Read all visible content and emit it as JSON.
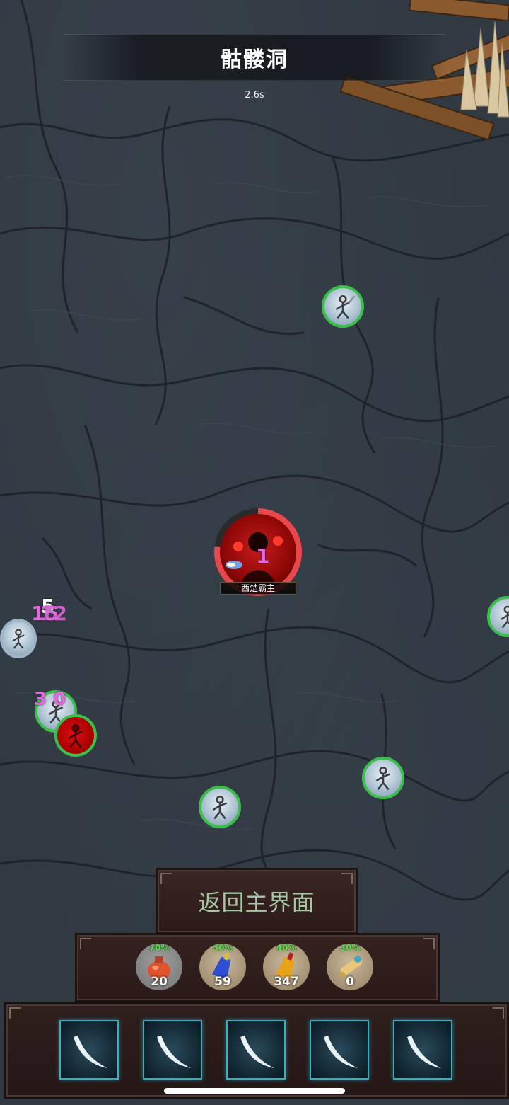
{
  "header": {
    "location_title": "骷髅洞",
    "timer": "2.6s"
  },
  "player": {
    "name": "西楚霸主"
  },
  "damage_numbers": [
    {
      "id": "hero-hit",
      "text": "1",
      "color": "pink"
    },
    {
      "id": "left-hit-a",
      "text": "5",
      "color": "white"
    },
    {
      "id": "left-hit-b",
      "text": "15",
      "color": "pink"
    },
    {
      "id": "left-hit-c",
      "text": "12",
      "color": "pink"
    },
    {
      "id": "left-hit-d",
      "text": "3 0",
      "color": "pink"
    }
  ],
  "actions": {
    "return_label": "返回主界面"
  },
  "potions": [
    {
      "name": "hp-potion-icon",
      "threshold": "70%",
      "count": "20"
    },
    {
      "name": "mp-potion-icon",
      "threshold": "50%",
      "count": "59"
    },
    {
      "name": "sun-potion-icon",
      "threshold": "40%",
      "count": "347"
    },
    {
      "name": "scroll-icon",
      "threshold": "30%",
      "count": "0"
    }
  ],
  "skills": [
    {
      "name": "slash-skill-icon"
    },
    {
      "name": "slash-skill-icon"
    },
    {
      "name": "slash-skill-icon"
    },
    {
      "name": "slash-skill-icon"
    },
    {
      "name": "slash-skill-icon"
    }
  ],
  "colors": {
    "ally_ring": "#3ac04a",
    "hero_hp_ring": "#e8474b",
    "threshold_text": "#54e446",
    "damage_pink": "#e16bdc",
    "return_text": "#a5c7a4",
    "skill_border": "#2fb2c4"
  }
}
